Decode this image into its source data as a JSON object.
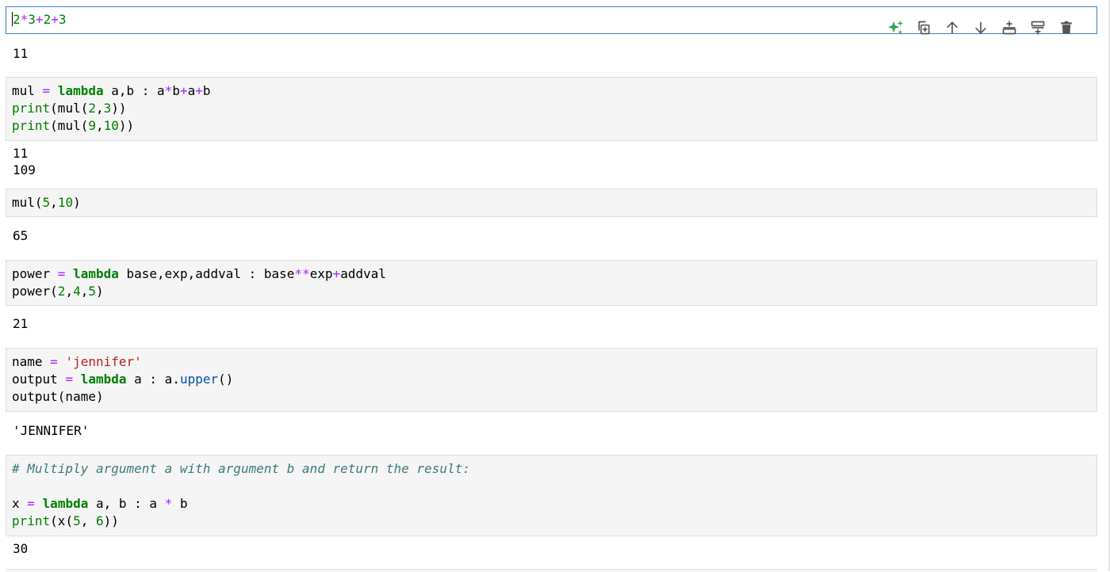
{
  "toolbar": {
    "icons": [
      "sparkle-icon",
      "duplicate-icon",
      "move-up-icon",
      "move-down-icon",
      "insert-above-icon",
      "insert-below-icon",
      "delete-icon"
    ],
    "accent_color": "#3d7fc5",
    "sparkle_color": "#2ea44f"
  },
  "cells": [
    {
      "input": [
        [
          "2",
          "*",
          "3",
          "+",
          "2",
          "+",
          "3"
        ]
      ],
      "output": [
        "11"
      ]
    },
    {
      "input": [
        [
          "mul ",
          "=",
          " ",
          "lambda",
          " a,b : a",
          "*",
          "b",
          "+",
          "a",
          "+",
          "b"
        ],
        [
          "print",
          "(mul(",
          "2",
          ",",
          "3",
          "))"
        ],
        [
          "print",
          "(mul(",
          "9",
          ",",
          "10",
          "))"
        ]
      ],
      "output": [
        "11",
        "109"
      ]
    },
    {
      "input": [
        [
          "mul(",
          "5",
          ",",
          "10",
          ")"
        ]
      ],
      "output": [
        "65"
      ]
    },
    {
      "input": [
        [
          "power ",
          "=",
          " ",
          "lambda",
          " base,exp,addval : base",
          "**",
          "exp",
          "+",
          "addval"
        ],
        [
          "power(",
          "2",
          ",",
          "4",
          ",",
          "5",
          ")"
        ]
      ],
      "output": [
        "21"
      ]
    },
    {
      "input": [
        [
          "name ",
          "=",
          " ",
          "'jennifer'"
        ],
        [
          "output ",
          "=",
          " ",
          "lambda",
          " a : a.",
          "upper",
          "()"
        ],
        [
          "output(name)"
        ]
      ],
      "output": [
        "'JENNIFER'"
      ]
    },
    {
      "input": [
        [
          "# Multiply argument a with argument b and return the result:"
        ],
        [
          ""
        ],
        [
          "x ",
          "=",
          " ",
          "lambda",
          " a, b : a ",
          "*",
          " b"
        ],
        [
          "print",
          "(x(",
          "5",
          ", ",
          "6",
          "))"
        ]
      ],
      "output": [
        "30"
      ]
    }
  ]
}
